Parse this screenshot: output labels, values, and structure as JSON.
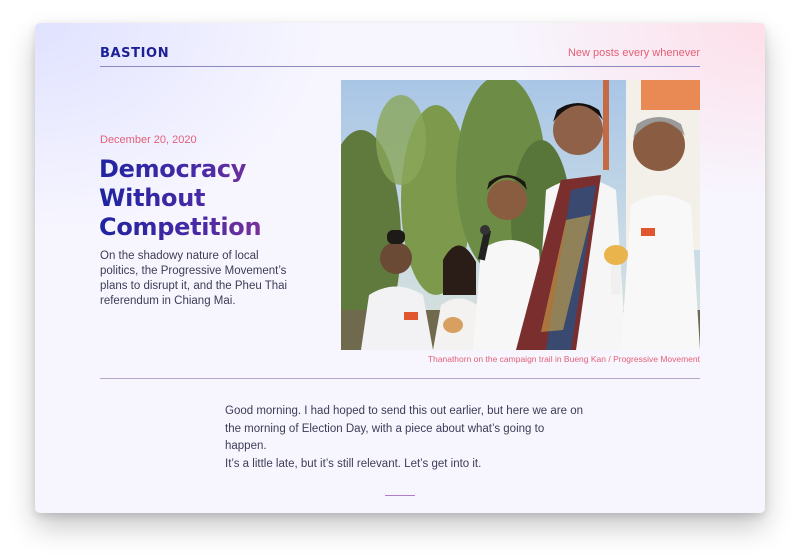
{
  "site": {
    "brand": "BASTION",
    "tagline": "New posts every whenever"
  },
  "article": {
    "date": "December 20, 2020",
    "title_lines": [
      "Democracy",
      "Without",
      "Competition"
    ],
    "summary": "On the shadowy nature of local politics, the Progressive Movement’s plans to disrupt it, and the Pheu Thai referendum in Chiang Mai.",
    "photo_caption": "Thanathorn on the campaign trail in Bueng Kan / Progressive Movement",
    "body_paragraphs": [
      "Good morning. I had hoped to send this out earlier, but here we are on the morning of Election Day, with a piece about what’s going to happen.",
      "It’s a little late, but it’s still relevant. Let’s get into it."
    ]
  },
  "colors": {
    "brand": "#1c1f96",
    "accent": "#e46077",
    "text": "#3c3c56"
  }
}
